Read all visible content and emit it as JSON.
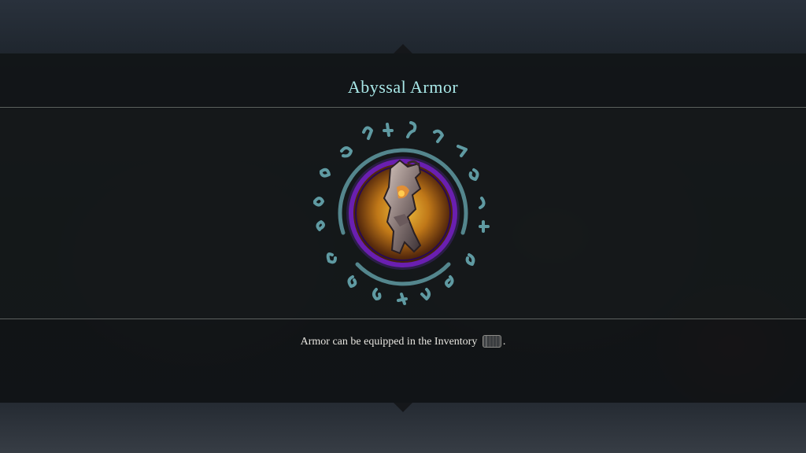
{
  "item": {
    "name": "Abyssal Armor",
    "icon": "abyssal-armor-gauntlet-icon"
  },
  "message": {
    "text": "Armor can be equipped in the Inventory",
    "key_icon": "inventory-key-icon",
    "end": "."
  },
  "colors": {
    "title": "#a9e8e8",
    "rune_ring": "#5f9aa2",
    "item_ring": "#6a1fb0",
    "item_glow": "#d69a20"
  }
}
